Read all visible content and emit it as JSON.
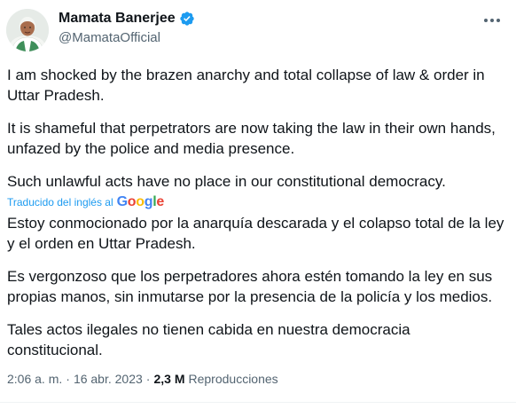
{
  "author": {
    "name": "Mamata Banerjee",
    "handle": "@MamataOfficial",
    "verified_icon": "verified-badge-icon"
  },
  "tweet": {
    "paragraphs": [
      "I am shocked by the brazen anarchy and total collapse of law & order in Uttar Pradesh.",
      "It is shameful that perpetrators are now taking the law in their own hands, unfazed by the police and media presence.",
      "Such unlawful acts have no place in our constitutional democracy."
    ],
    "translation_note": "Traducido del inglés al",
    "translation_provider": "Google",
    "translated_paragraphs": [
      "Estoy conmocionado por la anarquía descarada y el colapso total de la ley y el orden en Uttar Pradesh.",
      "Es vergonzoso que los perpetradores ahora estén tomando la ley en sus propias manos, sin inmutarse por la presencia de la policía y los medios.",
      "Tales actos ilegales no tienen cabida en nuestra democracia constitucional."
    ]
  },
  "meta": {
    "time": "2:06 a. m.",
    "separator": "·",
    "date": "16 abr. 2023",
    "views_count": "2,3 M",
    "views_label": "Reproducciones"
  },
  "colors": {
    "text": "#0f1419",
    "secondary": "#536471",
    "link": "#1d9bf0",
    "verified": "#1d9bf0"
  }
}
